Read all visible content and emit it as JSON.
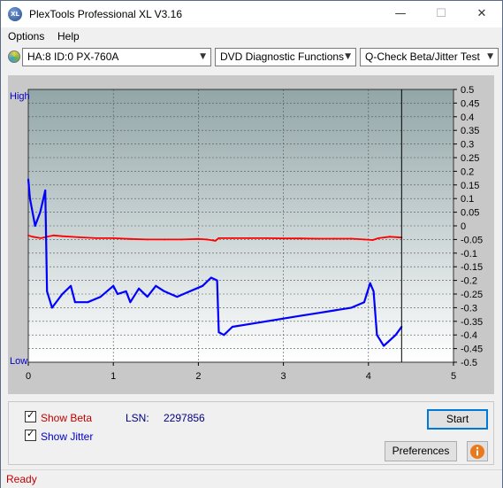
{
  "window": {
    "title": "PlexTools Professional XL V3.16",
    "app_icon": "XL"
  },
  "menu": [
    {
      "label": "Options"
    },
    {
      "label": "Help"
    }
  ],
  "toolbar": {
    "drive": "HA:8 ID:0  PX-760A",
    "function": "DVD Diagnostic Functions",
    "test": "Q-Check Beta/Jitter Test"
  },
  "chart_data": {
    "type": "line",
    "xlim": [
      0,
      5
    ],
    "x_ticks": [
      "0",
      "1",
      "2",
      "3",
      "4",
      "5"
    ],
    "ylim": [
      -0.5,
      0.5
    ],
    "y_ticks": [
      "0.5",
      "0.45",
      "0.4",
      "0.35",
      "0.3",
      "0.25",
      "0.2",
      "0.15",
      "0.1",
      "0.05",
      "0",
      "-0.05",
      "-0.1",
      "-0.15",
      "-0.2",
      "-0.25",
      "-0.3",
      "-0.35",
      "-0.4",
      "-0.45",
      "-0.5"
    ],
    "left_labels": {
      "high": "High",
      "low": "Low"
    },
    "marker_x": 4.39,
    "colors": {
      "beta": "#ff0000",
      "jitter": "#0000ff"
    },
    "series": [
      {
        "key": "beta",
        "points": [
          [
            0.0,
            -0.035
          ],
          [
            0.05,
            -0.04
          ],
          [
            0.15,
            -0.045
          ],
          [
            0.22,
            -0.04
          ],
          [
            0.3,
            -0.035
          ],
          [
            0.4,
            -0.038
          ],
          [
            0.6,
            -0.042
          ],
          [
            0.8,
            -0.045
          ],
          [
            1.0,
            -0.045
          ],
          [
            1.2,
            -0.048
          ],
          [
            1.4,
            -0.05
          ],
          [
            1.6,
            -0.05
          ],
          [
            1.8,
            -0.05
          ],
          [
            2.0,
            -0.048
          ],
          [
            2.1,
            -0.05
          ],
          [
            2.2,
            -0.055
          ],
          [
            2.24,
            -0.045
          ],
          [
            2.4,
            -0.045
          ],
          [
            2.6,
            -0.045
          ],
          [
            2.8,
            -0.045
          ],
          [
            3.0,
            -0.046
          ],
          [
            3.2,
            -0.046
          ],
          [
            3.4,
            -0.047
          ],
          [
            3.6,
            -0.047
          ],
          [
            3.8,
            -0.047
          ],
          [
            3.95,
            -0.05
          ],
          [
            4.05,
            -0.052
          ],
          [
            4.12,
            -0.045
          ],
          [
            4.25,
            -0.04
          ],
          [
            4.39,
            -0.043
          ]
        ]
      },
      {
        "key": "jitter",
        "points": [
          [
            0.0,
            0.17
          ],
          [
            0.02,
            0.1
          ],
          [
            0.08,
            0.0
          ],
          [
            0.14,
            0.05
          ],
          [
            0.2,
            0.13
          ],
          [
            0.22,
            -0.24
          ],
          [
            0.28,
            -0.3
          ],
          [
            0.4,
            -0.25
          ],
          [
            0.5,
            -0.22
          ],
          [
            0.55,
            -0.28
          ],
          [
            0.7,
            -0.28
          ],
          [
            0.85,
            -0.26
          ],
          [
            1.0,
            -0.22
          ],
          [
            1.05,
            -0.25
          ],
          [
            1.15,
            -0.24
          ],
          [
            1.2,
            -0.28
          ],
          [
            1.3,
            -0.23
          ],
          [
            1.4,
            -0.26
          ],
          [
            1.5,
            -0.22
          ],
          [
            1.6,
            -0.24
          ],
          [
            1.75,
            -0.26
          ],
          [
            1.9,
            -0.24
          ],
          [
            2.05,
            -0.22
          ],
          [
            2.15,
            -0.19
          ],
          [
            2.22,
            -0.2
          ],
          [
            2.24,
            -0.39
          ],
          [
            2.3,
            -0.4
          ],
          [
            2.4,
            -0.37
          ],
          [
            2.6,
            -0.36
          ],
          [
            2.8,
            -0.35
          ],
          [
            3.0,
            -0.34
          ],
          [
            3.2,
            -0.33
          ],
          [
            3.4,
            -0.32
          ],
          [
            3.6,
            -0.31
          ],
          [
            3.8,
            -0.3
          ],
          [
            3.95,
            -0.28
          ],
          [
            4.02,
            -0.21
          ],
          [
            4.06,
            -0.24
          ],
          [
            4.1,
            -0.4
          ],
          [
            4.18,
            -0.44
          ],
          [
            4.25,
            -0.42
          ],
          [
            4.32,
            -0.4
          ],
          [
            4.39,
            -0.37
          ]
        ]
      }
    ]
  },
  "controls": {
    "show_beta": {
      "label": "Show Beta",
      "checked": true
    },
    "show_jitter": {
      "label": "Show Jitter",
      "checked": true
    },
    "lsn_label": "LSN:",
    "lsn_value": "2297856",
    "start": "Start",
    "preferences": "Preferences"
  },
  "status": "Ready"
}
